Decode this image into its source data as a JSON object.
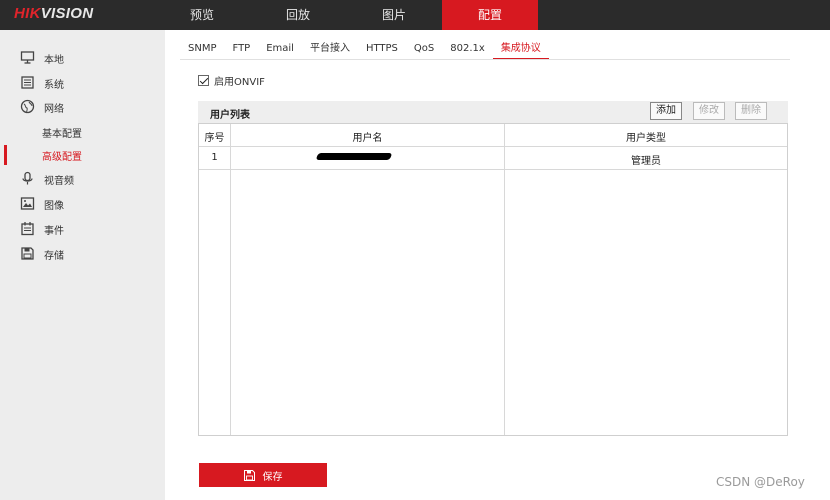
{
  "logo": {
    "part1": "HIK",
    "part2": "VISION"
  },
  "nav": [
    "预览",
    "回放",
    "图片",
    "配置"
  ],
  "nav_active": "配置",
  "sidebar": {
    "local": "本地",
    "system": "系统",
    "network": "网络",
    "basic_config": "基本配置",
    "advanced_config": "高级配置",
    "video_audio": "视音频",
    "image": "图像",
    "event": "事件",
    "storage": "存储"
  },
  "tabs": [
    "SNMP",
    "FTP",
    "Email",
    "平台接入",
    "HTTPS",
    "QoS",
    "802.1x",
    "集成协议"
  ],
  "tab_active": "集成协议",
  "onvif": {
    "label": "启用ONVIF",
    "checked": true
  },
  "user_list": {
    "title": "用户列表",
    "add": "添加",
    "modify": "修改",
    "delete": "删除",
    "columns": [
      "序号",
      "用户名",
      "用户类型"
    ],
    "rows": [
      {
        "index": "1",
        "username": "",
        "user_type": "管理员"
      }
    ]
  },
  "save_label": "保存",
  "watermark": "CSDN @DeRoy",
  "colors": {
    "accent": "#d71920",
    "topbar": "#2b2b2b",
    "sidebar": "#ededed"
  }
}
